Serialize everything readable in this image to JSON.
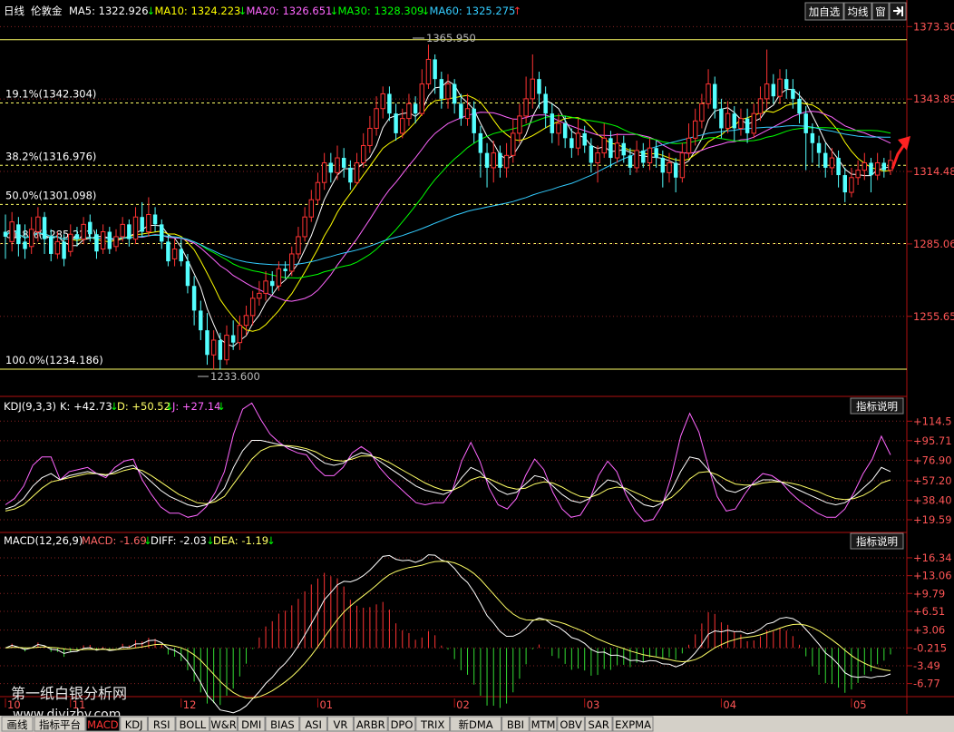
{
  "header": {
    "period": "日线",
    "symbol": "伦敦金",
    "ma_items": [
      {
        "label": "MA5: 1322.926",
        "arrow": "↓",
        "color": "#ffffff",
        "arrow_color": "#00ff00"
      },
      {
        "label": "MA10: 1324.223",
        "arrow": "↓",
        "color": "#ffff00",
        "arrow_color": "#00ff00"
      },
      {
        "label": "MA20: 1326.651",
        "arrow": "↓",
        "color": "#ff66ff",
        "arrow_color": "#00ff00"
      },
      {
        "label": "MA30: 1328.309",
        "arrow": "↓",
        "color": "#00ff00",
        "arrow_color": "#00ff00"
      },
      {
        "label": "MA60: 1325.275",
        "arrow": "↑",
        "color": "#33ccff",
        "arrow_color": "#ff3333"
      }
    ],
    "buttons": [
      "加自选",
      "均线",
      "窗"
    ],
    "arrow_icon": "exit-arrow-icon"
  },
  "price_axis": [
    "1373.303",
    "1343.892",
    "1314.481",
    "1285.069",
    "1255.658"
  ],
  "fib_levels": [
    {
      "label": "19.1%(1342.304)",
      "price": 1342.304
    },
    {
      "label": "38.2%(1316.976)",
      "price": 1316.976
    },
    {
      "label": "50.0%(1301.098)",
      "price": 1301.098
    },
    {
      "label": "61.8%(1285.221)",
      "price": 1285.221
    },
    {
      "label": "100.0%(1234.186)",
      "price": 1234.186
    }
  ],
  "fib_top_price": 1368.0,
  "high_marker": "1365.950",
  "low_marker": "1233.600",
  "kdj": {
    "title": "KDJ(9,3,3)",
    "k_label": "K: +42.73",
    "k_arrow": "↓",
    "d_label": "D: +50.52",
    "d_arrow": "↓",
    "j_label": "J: +27.14",
    "j_arrow": "↓",
    "button": "指标说明",
    "axis": [
      "+114.5",
      "+95.71",
      "+76.90",
      "+57.20",
      "+38.40",
      "+19.59"
    ]
  },
  "macd": {
    "title": "MACD(12,26,9)",
    "macd_label": "MACD: -1.69",
    "macd_arrow": "↓",
    "diff_label": "DIFF: -2.03",
    "diff_arrow": "↓",
    "dea_label": "DEA: -1.19",
    "dea_arrow": "↓",
    "button": "指标说明",
    "axis": [
      "+16.34",
      "+13.06",
      "+9.79",
      "+6.51",
      "+3.06",
      "-0.215",
      "-3.49",
      "-6.77"
    ]
  },
  "months": [
    "10",
    "11",
    "12",
    "01",
    "02",
    "03",
    "04",
    "05"
  ],
  "watermark": {
    "line1": "第一纸白银分析网",
    "line2": "www.diyizby.com"
  },
  "tabs": [
    "指标平台",
    "MACD",
    "KDJ",
    "RSI",
    "BOLL",
    "W&R",
    "DMI",
    "BIAS",
    "ASI",
    "VR",
    "ARBR",
    "DPO",
    "TRIX",
    "新DMA",
    "BBI",
    "MTM",
    "OBV",
    "SAR",
    "EXPMA"
  ],
  "tab_first": "画线",
  "active_tab": "MACD",
  "chart_data": {
    "type": "candlestick",
    "price_range": [
      1225,
      1376
    ],
    "kdj_range": [
      10,
      120
    ],
    "macd_range": [
      -8.5,
      17.5
    ],
    "macd_zero": -0.215,
    "candles": [
      {
        "o": 1290,
        "c": 1288,
        "h": 1297,
        "l": 1279
      },
      {
        "o": 1286,
        "c": 1294,
        "h": 1298,
        "l": 1282
      },
      {
        "o": 1293,
        "c": 1285,
        "h": 1296,
        "l": 1280
      },
      {
        "o": 1286,
        "c": 1283,
        "h": 1293,
        "l": 1279
      },
      {
        "o": 1284,
        "c": 1291,
        "h": 1296,
        "l": 1281
      },
      {
        "o": 1290,
        "c": 1296,
        "h": 1300,
        "l": 1286
      },
      {
        "o": 1296,
        "c": 1287,
        "h": 1298,
        "l": 1281
      },
      {
        "o": 1288,
        "c": 1281,
        "h": 1291,
        "l": 1278
      },
      {
        "o": 1281,
        "c": 1286,
        "h": 1290,
        "l": 1279
      },
      {
        "o": 1286,
        "c": 1279,
        "h": 1289,
        "l": 1276
      },
      {
        "o": 1282,
        "c": 1289,
        "h": 1293,
        "l": 1280
      },
      {
        "o": 1289,
        "c": 1287,
        "h": 1292,
        "l": 1284
      },
      {
        "o": 1287,
        "c": 1293,
        "h": 1296,
        "l": 1285
      },
      {
        "o": 1294,
        "c": 1289,
        "h": 1297,
        "l": 1286
      },
      {
        "o": 1289,
        "c": 1282,
        "h": 1291,
        "l": 1279
      },
      {
        "o": 1283,
        "c": 1290,
        "h": 1293,
        "l": 1281
      },
      {
        "o": 1290,
        "c": 1283,
        "h": 1292,
        "l": 1281
      },
      {
        "o": 1284,
        "c": 1288,
        "h": 1291,
        "l": 1282
      },
      {
        "o": 1288,
        "c": 1293,
        "h": 1296,
        "l": 1286
      },
      {
        "o": 1293,
        "c": 1287,
        "h": 1295,
        "l": 1284
      },
      {
        "o": 1287,
        "c": 1296,
        "h": 1300,
        "l": 1285
      },
      {
        "o": 1296,
        "c": 1290,
        "h": 1302,
        "l": 1288
      },
      {
        "o": 1290,
        "c": 1297,
        "h": 1304,
        "l": 1288
      },
      {
        "o": 1297,
        "c": 1293,
        "h": 1300,
        "l": 1290
      },
      {
        "o": 1293,
        "c": 1286,
        "h": 1295,
        "l": 1283
      },
      {
        "o": 1286,
        "c": 1278,
        "h": 1289,
        "l": 1276
      },
      {
        "o": 1279,
        "c": 1283,
        "h": 1287,
        "l": 1276
      },
      {
        "o": 1283,
        "c": 1278,
        "h": 1287,
        "l": 1276
      },
      {
        "o": 1278,
        "c": 1268,
        "h": 1281,
        "l": 1265
      },
      {
        "o": 1268,
        "c": 1258,
        "h": 1272,
        "l": 1252
      },
      {
        "o": 1258,
        "c": 1250,
        "h": 1262,
        "l": 1246
      },
      {
        "o": 1250,
        "c": 1240,
        "h": 1257,
        "l": 1236
      },
      {
        "o": 1240,
        "c": 1246,
        "h": 1250,
        "l": 1234
      },
      {
        "o": 1246,
        "c": 1238,
        "h": 1249,
        "l": 1234
      },
      {
        "o": 1238,
        "c": 1248,
        "h": 1252,
        "l": 1236
      },
      {
        "o": 1248,
        "c": 1245,
        "h": 1254,
        "l": 1242
      },
      {
        "o": 1245,
        "c": 1252,
        "h": 1256,
        "l": 1242
      },
      {
        "o": 1252,
        "c": 1256,
        "h": 1260,
        "l": 1248
      },
      {
        "o": 1256,
        "c": 1263,
        "h": 1266,
        "l": 1252
      },
      {
        "o": 1263,
        "c": 1265,
        "h": 1270,
        "l": 1260
      },
      {
        "o": 1265,
        "c": 1270,
        "h": 1274,
        "l": 1262
      },
      {
        "o": 1270,
        "c": 1268,
        "h": 1274,
        "l": 1265
      },
      {
        "o": 1268,
        "c": 1275,
        "h": 1278,
        "l": 1266
      },
      {
        "o": 1275,
        "c": 1274,
        "h": 1278,
        "l": 1271
      },
      {
        "o": 1274,
        "c": 1281,
        "h": 1284,
        "l": 1272
      },
      {
        "o": 1281,
        "c": 1288,
        "h": 1292,
        "l": 1279
      },
      {
        "o": 1288,
        "c": 1296,
        "h": 1300,
        "l": 1286
      },
      {
        "o": 1296,
        "c": 1303,
        "h": 1307,
        "l": 1294
      },
      {
        "o": 1303,
        "c": 1310,
        "h": 1314,
        "l": 1301
      },
      {
        "o": 1310,
        "c": 1318,
        "h": 1322,
        "l": 1307
      },
      {
        "o": 1318,
        "c": 1314,
        "h": 1322,
        "l": 1310
      },
      {
        "o": 1314,
        "c": 1320,
        "h": 1325,
        "l": 1311
      },
      {
        "o": 1320,
        "c": 1316,
        "h": 1324,
        "l": 1312
      },
      {
        "o": 1316,
        "c": 1310,
        "h": 1319,
        "l": 1307
      },
      {
        "o": 1310,
        "c": 1318,
        "h": 1322,
        "l": 1309
      },
      {
        "o": 1318,
        "c": 1325,
        "h": 1330,
        "l": 1316
      },
      {
        "o": 1325,
        "c": 1332,
        "h": 1337,
        "l": 1322
      },
      {
        "o": 1332,
        "c": 1340,
        "h": 1345,
        "l": 1329
      },
      {
        "o": 1340,
        "c": 1346,
        "h": 1349,
        "l": 1336
      },
      {
        "o": 1346,
        "c": 1338,
        "h": 1349,
        "l": 1335
      },
      {
        "o": 1338,
        "c": 1330,
        "h": 1342,
        "l": 1327
      },
      {
        "o": 1330,
        "c": 1336,
        "h": 1340,
        "l": 1328
      },
      {
        "o": 1336,
        "c": 1342,
        "h": 1346,
        "l": 1333
      },
      {
        "o": 1342,
        "c": 1338,
        "h": 1345,
        "l": 1334
      },
      {
        "o": 1338,
        "c": 1350,
        "h": 1356,
        "l": 1337
      },
      {
        "o": 1350,
        "c": 1360,
        "h": 1366,
        "l": 1348
      },
      {
        "o": 1360,
        "c": 1352,
        "h": 1362,
        "l": 1346
      },
      {
        "o": 1352,
        "c": 1344,
        "h": 1355,
        "l": 1340
      },
      {
        "o": 1344,
        "c": 1350,
        "h": 1354,
        "l": 1340
      },
      {
        "o": 1350,
        "c": 1342,
        "h": 1352,
        "l": 1338
      },
      {
        "o": 1342,
        "c": 1336,
        "h": 1346,
        "l": 1333
      },
      {
        "o": 1336,
        "c": 1340,
        "h": 1346,
        "l": 1333
      },
      {
        "o": 1340,
        "c": 1330,
        "h": 1343,
        "l": 1326
      },
      {
        "o": 1330,
        "c": 1322,
        "h": 1333,
        "l": 1312
      },
      {
        "o": 1322,
        "c": 1316,
        "h": 1326,
        "l": 1308
      },
      {
        "o": 1316,
        "c": 1322,
        "h": 1327,
        "l": 1310
      },
      {
        "o": 1322,
        "c": 1316,
        "h": 1325,
        "l": 1312
      },
      {
        "o": 1316,
        "c": 1321,
        "h": 1326,
        "l": 1312
      },
      {
        "o": 1321,
        "c": 1330,
        "h": 1336,
        "l": 1318
      },
      {
        "o": 1330,
        "c": 1337,
        "h": 1342,
        "l": 1326
      },
      {
        "o": 1337,
        "c": 1344,
        "h": 1353,
        "l": 1334
      },
      {
        "o": 1344,
        "c": 1352,
        "h": 1362,
        "l": 1340
      },
      {
        "o": 1352,
        "c": 1346,
        "h": 1355,
        "l": 1340
      },
      {
        "o": 1346,
        "c": 1338,
        "h": 1349,
        "l": 1332
      },
      {
        "o": 1338,
        "c": 1330,
        "h": 1342,
        "l": 1326
      },
      {
        "o": 1330,
        "c": 1334,
        "h": 1338,
        "l": 1325
      },
      {
        "o": 1334,
        "c": 1328,
        "h": 1337,
        "l": 1324
      },
      {
        "o": 1328,
        "c": 1324,
        "h": 1332,
        "l": 1320
      },
      {
        "o": 1324,
        "c": 1330,
        "h": 1336,
        "l": 1321
      },
      {
        "o": 1330,
        "c": 1325,
        "h": 1333,
        "l": 1322
      },
      {
        "o": 1325,
        "c": 1318,
        "h": 1328,
        "l": 1314
      },
      {
        "o": 1318,
        "c": 1322,
        "h": 1325,
        "l": 1310
      },
      {
        "o": 1322,
        "c": 1328,
        "h": 1334,
        "l": 1320
      },
      {
        "o": 1328,
        "c": 1320,
        "h": 1331,
        "l": 1316
      },
      {
        "o": 1320,
        "c": 1326,
        "h": 1330,
        "l": 1318
      },
      {
        "o": 1326,
        "c": 1321,
        "h": 1329,
        "l": 1318
      },
      {
        "o": 1321,
        "c": 1316,
        "h": 1324,
        "l": 1313
      },
      {
        "o": 1316,
        "c": 1323,
        "h": 1327,
        "l": 1314
      },
      {
        "o": 1323,
        "c": 1318,
        "h": 1326,
        "l": 1316
      },
      {
        "o": 1318,
        "c": 1324,
        "h": 1328,
        "l": 1315
      },
      {
        "o": 1324,
        "c": 1320,
        "h": 1327,
        "l": 1316
      },
      {
        "o": 1320,
        "c": 1314,
        "h": 1323,
        "l": 1308
      },
      {
        "o": 1314,
        "c": 1318,
        "h": 1322,
        "l": 1310
      },
      {
        "o": 1318,
        "c": 1312,
        "h": 1320,
        "l": 1306
      },
      {
        "o": 1312,
        "c": 1322,
        "h": 1326,
        "l": 1310
      },
      {
        "o": 1322,
        "c": 1328,
        "h": 1334,
        "l": 1320
      },
      {
        "o": 1328,
        "c": 1335,
        "h": 1340,
        "l": 1325
      },
      {
        "o": 1335,
        "c": 1342,
        "h": 1346,
        "l": 1332
      },
      {
        "o": 1342,
        "c": 1350,
        "h": 1356,
        "l": 1340
      },
      {
        "o": 1350,
        "c": 1340,
        "h": 1353,
        "l": 1336
      },
      {
        "o": 1340,
        "c": 1332,
        "h": 1344,
        "l": 1328
      },
      {
        "o": 1332,
        "c": 1338,
        "h": 1343,
        "l": 1330
      },
      {
        "o": 1338,
        "c": 1332,
        "h": 1341,
        "l": 1327
      },
      {
        "o": 1332,
        "c": 1336,
        "h": 1340,
        "l": 1329
      },
      {
        "o": 1336,
        "c": 1330,
        "h": 1340,
        "l": 1326
      },
      {
        "o": 1330,
        "c": 1338,
        "h": 1342,
        "l": 1328
      },
      {
        "o": 1338,
        "c": 1344,
        "h": 1349,
        "l": 1335
      },
      {
        "o": 1344,
        "c": 1350,
        "h": 1364,
        "l": 1340
      },
      {
        "o": 1350,
        "c": 1345,
        "h": 1354,
        "l": 1342
      },
      {
        "o": 1345,
        "c": 1352,
        "h": 1356,
        "l": 1342
      },
      {
        "o": 1352,
        "c": 1348,
        "h": 1356,
        "l": 1344
      },
      {
        "o": 1348,
        "c": 1344,
        "h": 1352,
        "l": 1340
      },
      {
        "o": 1344,
        "c": 1338,
        "h": 1347,
        "l": 1334
      },
      {
        "o": 1338,
        "c": 1330,
        "h": 1341,
        "l": 1315
      },
      {
        "o": 1330,
        "c": 1326,
        "h": 1334,
        "l": 1318
      },
      {
        "o": 1326,
        "c": 1322,
        "h": 1329,
        "l": 1316
      },
      {
        "o": 1322,
        "c": 1316,
        "h": 1326,
        "l": 1312
      },
      {
        "o": 1316,
        "c": 1320,
        "h": 1324,
        "l": 1313
      },
      {
        "o": 1320,
        "c": 1313,
        "h": 1323,
        "l": 1308
      },
      {
        "o": 1313,
        "c": 1306,
        "h": 1316,
        "l": 1302
      },
      {
        "o": 1306,
        "c": 1312,
        "h": 1316,
        "l": 1304
      },
      {
        "o": 1312,
        "c": 1315,
        "h": 1319,
        "l": 1309
      },
      {
        "o": 1315,
        "c": 1318,
        "h": 1322,
        "l": 1311
      },
      {
        "o": 1318,
        "c": 1313,
        "h": 1320,
        "l": 1306
      },
      {
        "o": 1313,
        "c": 1318,
        "h": 1322,
        "l": 1311
      },
      {
        "o": 1318,
        "c": 1315,
        "h": 1320,
        "l": 1312
      },
      {
        "o": 1315,
        "c": 1319,
        "h": 1323,
        "l": 1313
      }
    ],
    "ma_lines": [
      {
        "name": "MA5",
        "color": "#ffffff",
        "values": []
      },
      {
        "name": "MA10",
        "color": "#ffff00",
        "values": []
      },
      {
        "name": "MA20",
        "color": "#ff66ff",
        "values": []
      },
      {
        "name": "MA30",
        "color": "#00ff00",
        "values": []
      },
      {
        "name": "MA60",
        "color": "#33ccff",
        "values": []
      }
    ],
    "kdj_series": {
      "K": [
        30,
        33,
        40,
        52,
        60,
        64,
        58,
        62,
        64,
        66,
        64,
        62,
        66,
        70,
        72,
        64,
        56,
        48,
        42,
        38,
        34,
        32,
        34,
        40,
        50,
        70,
        86,
        96,
        96,
        94,
        92,
        90,
        88,
        86,
        80,
        74,
        72,
        74,
        80,
        84,
        82,
        76,
        70,
        64,
        58,
        52,
        48,
        46,
        44,
        48,
        60,
        70,
        66,
        56,
        48,
        44,
        46,
        54,
        62,
        60,
        52,
        44,
        38,
        36,
        40,
        50,
        58,
        56,
        48,
        40,
        34,
        32,
        36,
        48,
        66,
        80,
        78,
        68,
        56,
        48,
        46,
        50,
        54,
        58,
        58,
        56,
        52,
        48,
        44,
        40,
        36,
        34,
        36,
        42,
        50,
        58,
        70,
        66
      ],
      "D": [
        28,
        30,
        34,
        42,
        50,
        56,
        58,
        60,
        62,
        64,
        64,
        63,
        64,
        67,
        69,
        67,
        62,
        56,
        50,
        44,
        40,
        36,
        35,
        37,
        42,
        54,
        66,
        78,
        86,
        90,
        91,
        91,
        90,
        88,
        85,
        80,
        77,
        76,
        78,
        81,
        81,
        79,
        75,
        70,
        65,
        60,
        55,
        51,
        48,
        48,
        52,
        58,
        61,
        59,
        55,
        51,
        49,
        50,
        54,
        56,
        55,
        51,
        46,
        42,
        41,
        44,
        49,
        51,
        50,
        46,
        42,
        38,
        37,
        41,
        49,
        59,
        65,
        66,
        63,
        58,
        54,
        53,
        53,
        55,
        56,
        56,
        55,
        53,
        50,
        47,
        43,
        40,
        39,
        40,
        43,
        48,
        55,
        58
      ],
      "J": [
        34,
        40,
        52,
        72,
        80,
        80,
        58,
        66,
        68,
        70,
        64,
        60,
        70,
        76,
        78,
        58,
        44,
        32,
        26,
        26,
        22,
        24,
        32,
        46,
        66,
        102,
        126,
        132,
        116,
        102,
        94,
        88,
        84,
        82,
        70,
        62,
        62,
        70,
        84,
        90,
        84,
        70,
        60,
        52,
        44,
        36,
        34,
        36,
        36,
        48,
        76,
        94,
        76,
        50,
        34,
        30,
        40,
        62,
        78,
        68,
        46,
        30,
        22,
        24,
        38,
        62,
        76,
        66,
        44,
        28,
        18,
        20,
        34,
        62,
        100,
        122,
        104,
        72,
        42,
        28,
        30,
        44,
        56,
        64,
        62,
        56,
        46,
        38,
        32,
        26,
        22,
        22,
        30,
        46,
        64,
        78,
        100,
        82
      ]
    },
    "macd_series": {
      "DIFF": [],
      "DEA": [],
      "HIST": []
    },
    "months": [
      "10",
      "11",
      "12",
      "01",
      "02",
      "03",
      "04",
      "05"
    ]
  }
}
